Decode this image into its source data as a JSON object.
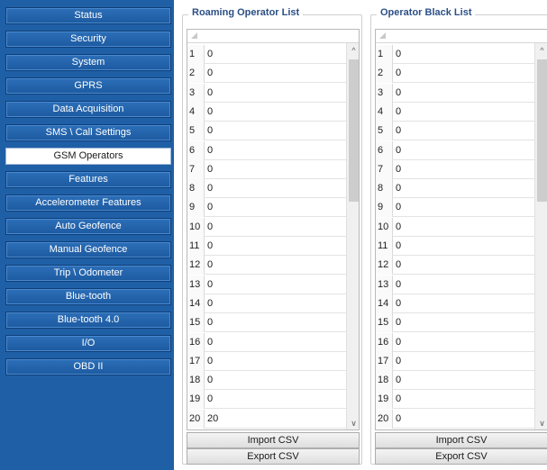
{
  "sidebar": {
    "items": [
      {
        "label": "Status"
      },
      {
        "label": "Security"
      },
      {
        "label": "System"
      },
      {
        "label": "GPRS"
      },
      {
        "label": "Data Acquisition"
      },
      {
        "label": "SMS \\ Call Settings"
      },
      {
        "label": "GSM Operators"
      },
      {
        "label": "Features"
      },
      {
        "label": "Accelerometer Features"
      },
      {
        "label": "Auto Geofence"
      },
      {
        "label": "Manual Geofence"
      },
      {
        "label": "Trip \\ Odometer"
      },
      {
        "label": "Blue-tooth"
      },
      {
        "label": "Blue-tooth 4.0"
      },
      {
        "label": "I/O"
      },
      {
        "label": "OBD II"
      }
    ],
    "active_item": "GSM Operators"
  },
  "roaming": {
    "title": "Roaming Operator List",
    "rows": [
      {
        "num": "1",
        "value": "0"
      },
      {
        "num": "2",
        "value": "0"
      },
      {
        "num": "3",
        "value": "0"
      },
      {
        "num": "4",
        "value": "0"
      },
      {
        "num": "5",
        "value": "0"
      },
      {
        "num": "6",
        "value": "0"
      },
      {
        "num": "7",
        "value": "0"
      },
      {
        "num": "8",
        "value": "0"
      },
      {
        "num": "9",
        "value": "0"
      },
      {
        "num": "10",
        "value": "0"
      },
      {
        "num": "11",
        "value": "0"
      },
      {
        "num": "12",
        "value": "0"
      },
      {
        "num": "13",
        "value": "0"
      },
      {
        "num": "14",
        "value": "0"
      },
      {
        "num": "15",
        "value": "0"
      },
      {
        "num": "16",
        "value": "0"
      },
      {
        "num": "17",
        "value": "0"
      },
      {
        "num": "18",
        "value": "0"
      },
      {
        "num": "19",
        "value": "0"
      },
      {
        "num": "20",
        "value": "20"
      }
    ],
    "import_label": "Import CSV",
    "export_label": "Export CSV"
  },
  "blacklist": {
    "title": "Operator Black List",
    "rows": [
      {
        "num": "1",
        "value": "0"
      },
      {
        "num": "2",
        "value": "0"
      },
      {
        "num": "3",
        "value": "0"
      },
      {
        "num": "4",
        "value": "0"
      },
      {
        "num": "5",
        "value": "0"
      },
      {
        "num": "6",
        "value": "0"
      },
      {
        "num": "7",
        "value": "0"
      },
      {
        "num": "8",
        "value": "0"
      },
      {
        "num": "9",
        "value": "0"
      },
      {
        "num": "10",
        "value": "0"
      },
      {
        "num": "11",
        "value": "0"
      },
      {
        "num": "12",
        "value": "0"
      },
      {
        "num": "13",
        "value": "0"
      },
      {
        "num": "14",
        "value": "0"
      },
      {
        "num": "15",
        "value": "0"
      },
      {
        "num": "16",
        "value": "0"
      },
      {
        "num": "17",
        "value": "0"
      },
      {
        "num": "18",
        "value": "0"
      },
      {
        "num": "19",
        "value": "0"
      },
      {
        "num": "20",
        "value": "0"
      }
    ],
    "import_label": "Import CSV",
    "export_label": "Export CSV"
  },
  "icons": {
    "scroll_up": "chevron-up-icon",
    "scroll_down": "chevron-down-icon",
    "grid_corner": "select-all-corner-icon"
  },
  "colors": {
    "sidebar_bg": "#1f5fa6",
    "button_bg": "#2c6fb8",
    "title_text": "#2b4f86"
  }
}
